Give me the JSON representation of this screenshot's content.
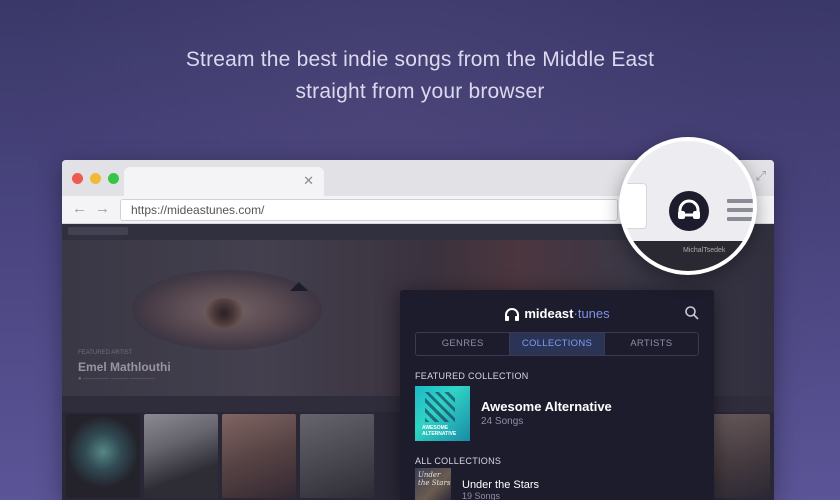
{
  "headline": {
    "line1": "Stream the best indie songs from the Middle East",
    "line2": "straight from your browser"
  },
  "browser": {
    "url": "https://mideastunes.com/",
    "tab_close": "✕",
    "back_icon": "arrow-left-icon",
    "forward_icon": "arrow-right-icon",
    "expand_icon": "expand-icon"
  },
  "site": {
    "artist_label": "FEATURED ARTIST",
    "artist_name": "Emel Mathlouthi",
    "magnifier_strip_text": "MichalTsedek"
  },
  "popup": {
    "brand_main": "mideast",
    "brand_accent": "·tunes",
    "tabs": [
      {
        "label": "GENRES",
        "active": false
      },
      {
        "label": "COLLECTIONS",
        "active": true
      },
      {
        "label": "ARTISTS",
        "active": false
      }
    ],
    "featured_heading": "FEATURED COLLECTION",
    "featured": {
      "art_caption": "AWESOME ALTERNATIVE",
      "title": "Awesome Alternative",
      "count": "24 Songs"
    },
    "all_heading": "ALL COLLECTIONS",
    "collections": [
      {
        "art_caption": "Under the Stars",
        "title": "Under the Stars",
        "count": "19 Songs"
      }
    ]
  },
  "colors": {
    "accent": "#7b92e8",
    "popup_bg": "#1c1c2c",
    "page_bg": "#4a4580"
  }
}
